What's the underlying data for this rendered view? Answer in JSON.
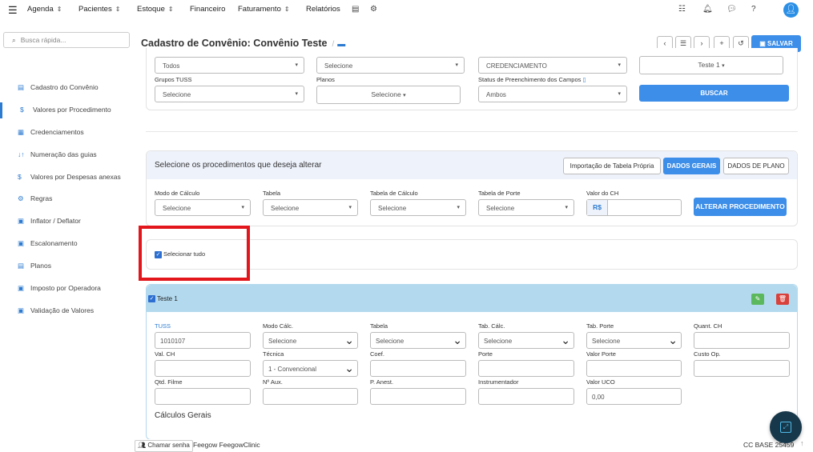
{
  "topnav": {
    "menu_icon": "hamburger-icon",
    "items": [
      {
        "label": "Agenda",
        "chevron": true
      },
      {
        "label": "Pacientes",
        "chevron": true
      },
      {
        "label": "Estoque",
        "chevron": true
      },
      {
        "label": "Financeiro",
        "chevron": false
      },
      {
        "label": "Faturamento",
        "chevron": true
      },
      {
        "label": "Relatórios",
        "chevron": false
      }
    ],
    "icons": [
      "database-icon",
      "gear-icon",
      "list-icon",
      "bell-icon",
      "chat-icon",
      "help-icon",
      "user-avatar-icon"
    ]
  },
  "sidebar": {
    "search_placeholder": "Busca rápida...",
    "items": [
      {
        "label": "Cadastro do Convênio",
        "icon": "card-icon",
        "glyph": "▤"
      },
      {
        "label": "Valores por Procedimento",
        "icon": "dollar-icon",
        "glyph": "$",
        "active": true
      },
      {
        "label": "Credenciamentos",
        "icon": "document-icon",
        "glyph": "▦"
      },
      {
        "label": "Numeração das guias",
        "icon": "sort-icon",
        "glyph": "↓↑"
      },
      {
        "label": "Valores por Despesas anexas",
        "icon": "dollar-icon",
        "glyph": "$"
      },
      {
        "label": "Regras",
        "icon": "gears-icon",
        "glyph": "⚙"
      },
      {
        "label": "Inflator / Deflator",
        "icon": "money-icon",
        "glyph": "▣"
      },
      {
        "label": "Escalonamento",
        "icon": "money-icon",
        "glyph": "▣"
      },
      {
        "label": "Planos",
        "icon": "list-icon",
        "glyph": "▤"
      },
      {
        "label": "Imposto por Operadora",
        "icon": "money-icon",
        "glyph": "▣"
      },
      {
        "label": "Validação de Valores",
        "icon": "money-icon",
        "glyph": "▣"
      }
    ]
  },
  "header": {
    "title": "Cadastro de Convênio: Convênio Teste",
    "separator": "/",
    "save_label": "SALVAR",
    "buttons": [
      "chevron-left-icon",
      "list-icon",
      "chevron-right-icon",
      "plus-icon",
      "history-icon"
    ]
  },
  "filters": {
    "row1": {
      "todos": "Todos",
      "selecione": "Selecione",
      "credenciamento": "CREDENCIAMENTO",
      "teste": "Teste 1"
    },
    "labels": {
      "grupos": "Grupos TUSS",
      "planos": "Planos",
      "status": "Status de Preenchimento dos Campos"
    },
    "row2": {
      "grupos_value": "Selecione",
      "planos_value": "Selecione",
      "status_value": "Ambos"
    },
    "buscar_label": "BUSCAR"
  },
  "alterar": {
    "title": "Selecione os procedimentos que deseja alterar",
    "tabs": {
      "importacao": "Importação de Tabela Própria",
      "dados_gerais": "DADOS GERAIS",
      "dados_plano": "DADOS DE PLANO"
    },
    "labels": {
      "modo": "Modo de Cálculo",
      "tabela": "Tabela",
      "tabela_calc": "Tabela de Cálculo",
      "tabela_porte": "Tabela de Porte",
      "valor_ch": "Valor do CH"
    },
    "values": {
      "modo": "Selecione",
      "tabela": "Selecione",
      "tabela_calc": "Selecione",
      "tabela_porte": "Selecione",
      "currency": "R$"
    },
    "button_label": "ALTERAR PROCEDIMENTO"
  },
  "select_all": {
    "label": "Selecionar tudo"
  },
  "item": {
    "name": "Teste 1",
    "labels": {
      "tuss": "TUSS",
      "modo_calc": "Modo Cálc.",
      "tabela": "Tabela",
      "tab_calc": "Tab. Cálc.",
      "tab_porte": "Tab. Porte",
      "quant_ch": "Quant. CH",
      "val_ch": "Val. CH",
      "tecnica": "Técnica",
      "coef": "Coef.",
      "porte": "Porte",
      "valor_porte": "Valor Porte",
      "custo_op": "Custo Op.",
      "qtd_filme": "Qtd. Filme",
      "n_aux": "Nº Aux.",
      "p_anest": "P. Anest.",
      "instrumentador": "Instrumentador",
      "valor_uco": "Valor UCO"
    },
    "values": {
      "tuss": "1010107",
      "modo_calc": "Selecione",
      "tabela": "Selecione",
      "tab_calc": "Selecione",
      "tab_porte": "Selecione",
      "tecnica": "1 - Convencional",
      "valor_uco": "0,00"
    },
    "section_title": "Cálculos Gerais"
  },
  "footer": {
    "chat_label": "Chamar senha",
    "brand": "Feegow FeegowClinic",
    "base": "CC BASE 25459"
  },
  "colors": {
    "accent": "#3d8ee8",
    "highlight_box": "#e2161b",
    "item_header": "#b3d9ee"
  }
}
